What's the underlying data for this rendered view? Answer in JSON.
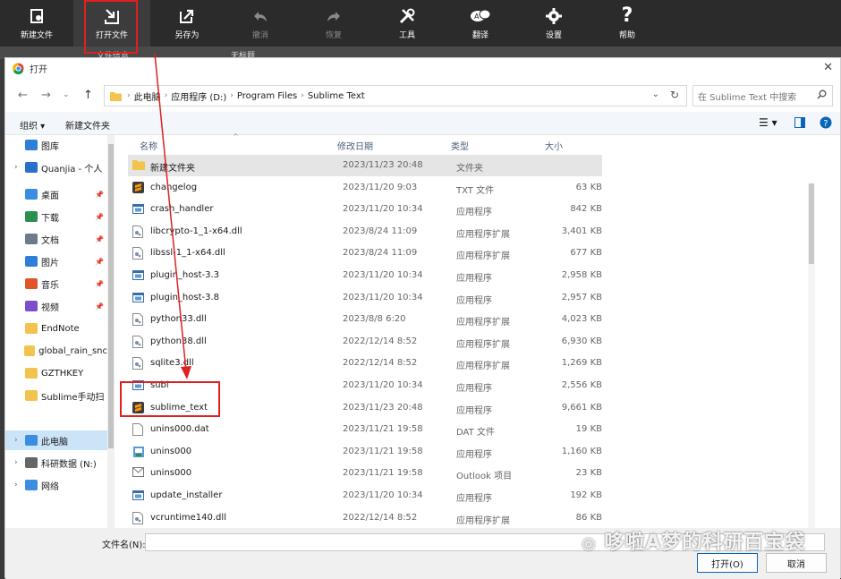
{
  "toolbar": {
    "items": [
      {
        "label": "新建文件",
        "icon": "new-file-icon"
      },
      {
        "label": "打开文件",
        "icon": "open-file-icon"
      },
      {
        "label": "另存为",
        "icon": "save-as-icon"
      },
      {
        "label": "撤消",
        "icon": "undo-icon"
      },
      {
        "label": "恢复",
        "icon": "redo-icon"
      },
      {
        "label": "工具",
        "icon": "tools-icon"
      },
      {
        "label": "翻译",
        "icon": "translate-icon"
      },
      {
        "label": "设置",
        "icon": "gear-icon"
      },
      {
        "label": "帮助",
        "icon": "help-icon"
      }
    ]
  },
  "tabs": {
    "tab1": "文件信息",
    "tab2": "无标题"
  },
  "dialog": {
    "title": "打开",
    "address": {
      "crumbs": [
        "此电脑",
        "应用程序 (D:)",
        "Program Files",
        "Sublime Text"
      ]
    },
    "search_placeholder": "在 Sublime Text 中搜索",
    "commands": {
      "organize": "组织",
      "new_folder": "新建文件夹"
    },
    "sidebar": [
      {
        "label": "图库",
        "icon": "gallery-icon",
        "color": "#2f7fd8",
        "expand": false,
        "pin": false
      },
      {
        "label": "Quanjia - 个人",
        "icon": "cloud-icon",
        "color": "#2a6fc9",
        "expand": true,
        "pin": false
      },
      {
        "label": "桌面",
        "icon": "desktop-icon",
        "color": "#3a8de0",
        "expand": false,
        "pin": true
      },
      {
        "label": "下载",
        "icon": "download-icon",
        "color": "#2b8f4e",
        "expand": false,
        "pin": true
      },
      {
        "label": "文档",
        "icon": "documents-icon",
        "color": "#6b7b8c",
        "expand": false,
        "pin": true
      },
      {
        "label": "图片",
        "icon": "pictures-icon",
        "color": "#2f7fd8",
        "expand": false,
        "pin": true
      },
      {
        "label": "音乐",
        "icon": "music-icon",
        "color": "#e0542a",
        "expand": false,
        "pin": true
      },
      {
        "label": "视频",
        "icon": "video-icon",
        "color": "#7a4fc9",
        "expand": false,
        "pin": true
      },
      {
        "label": "EndNote",
        "icon": "folder-icon",
        "color": "#f2c44d",
        "expand": false,
        "pin": false
      },
      {
        "label": "global_rain_snc",
        "icon": "folder-icon",
        "color": "#f2c44d",
        "expand": false,
        "pin": false
      },
      {
        "label": "GZTHKEY",
        "icon": "folder-icon",
        "color": "#f2c44d",
        "expand": false,
        "pin": false
      },
      {
        "label": "Sublime手动扫",
        "icon": "folder-icon",
        "color": "#f2c44d",
        "expand": false,
        "pin": false
      },
      {
        "label": "此电脑",
        "icon": "this-pc-icon",
        "color": "#3a8de0",
        "expand": true,
        "pin": false,
        "selected": true
      },
      {
        "label": "科研数据 (N:)",
        "icon": "drive-icon",
        "color": "#666666",
        "expand": true,
        "pin": false
      },
      {
        "label": "网络",
        "icon": "network-icon",
        "color": "#3a8de0",
        "expand": true,
        "pin": false
      }
    ],
    "columns": {
      "name": "名称",
      "date": "修改日期",
      "type": "类型",
      "size": "大小"
    },
    "files": [
      {
        "name": "新建文件夹",
        "date": "2023/11/23 20:48",
        "type": "文件夹",
        "size": "",
        "icon": "folder-icon"
      },
      {
        "name": "changelog",
        "date": "2023/11/20 9:03",
        "type": "TXT 文件",
        "size": "63 KB",
        "icon": "sublime-icon"
      },
      {
        "name": "crash_handler",
        "date": "2023/11/20 10:34",
        "type": "应用程序",
        "size": "842 KB",
        "icon": "app-icon"
      },
      {
        "name": "libcrypto-1_1-x64.dll",
        "date": "2023/8/24 11:09",
        "type": "应用程序扩展",
        "size": "3,401 KB",
        "icon": "dll-icon"
      },
      {
        "name": "libssl-1_1-x64.dll",
        "date": "2023/8/24 11:09",
        "type": "应用程序扩展",
        "size": "677 KB",
        "icon": "dll-icon"
      },
      {
        "name": "plugin_host-3.3",
        "date": "2023/11/20 10:34",
        "type": "应用程序",
        "size": "2,958 KB",
        "icon": "app-icon"
      },
      {
        "name": "plugin_host-3.8",
        "date": "2023/11/20 10:34",
        "type": "应用程序",
        "size": "2,957 KB",
        "icon": "app-icon"
      },
      {
        "name": "python33.dll",
        "date": "2023/8/8 6:20",
        "type": "应用程序扩展",
        "size": "4,023 KB",
        "icon": "dll-icon"
      },
      {
        "name": "python38.dll",
        "date": "2022/12/14 8:52",
        "type": "应用程序扩展",
        "size": "6,930 KB",
        "icon": "dll-icon"
      },
      {
        "name": "sqlite3.dll",
        "date": "2022/12/14 8:52",
        "type": "应用程序扩展",
        "size": "1,269 KB",
        "icon": "dll-icon"
      },
      {
        "name": "subl",
        "date": "2023/11/20 10:34",
        "type": "应用程序",
        "size": "2,556 KB",
        "icon": "app-icon"
      },
      {
        "name": "sublime_text",
        "date": "2023/11/23 20:48",
        "type": "应用程序",
        "size": "9,661 KB",
        "icon": "sublime-icon"
      },
      {
        "name": "unins000.dat",
        "date": "2023/11/21 19:58",
        "type": "DAT 文件",
        "size": "19 KB",
        "icon": "blank-file-icon"
      },
      {
        "name": "unins000",
        "date": "2023/11/21 19:58",
        "type": "应用程序",
        "size": "1,160 KB",
        "icon": "installer-icon"
      },
      {
        "name": "unins000",
        "date": "2023/11/21 19:58",
        "type": "Outlook 项目",
        "size": "23 KB",
        "icon": "mail-icon"
      },
      {
        "name": "update_installer",
        "date": "2023/11/20 10:34",
        "type": "应用程序",
        "size": "192 KB",
        "icon": "app-icon"
      },
      {
        "name": "vcruntime140.dll",
        "date": "2022/12/14 8:52",
        "type": "应用程序扩展",
        "size": "86 KB",
        "icon": "dll-icon"
      }
    ],
    "filename_label": "文件名(N):",
    "filename_value": "",
    "open_button": "打开(O)",
    "cancel_button": "取消"
  },
  "watermark": "哆啦A梦的科研百宝袋",
  "colors": {
    "highlight": "#e02020",
    "accent": "#0a64b8"
  }
}
